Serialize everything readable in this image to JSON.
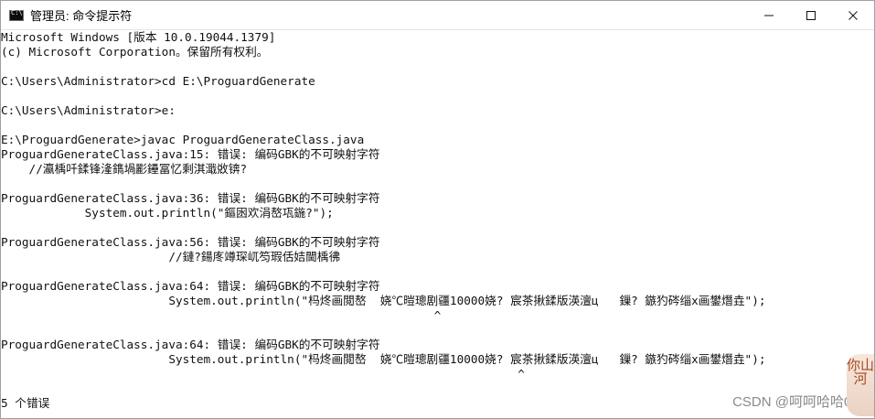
{
  "window": {
    "title": "管理员: 命令提示符",
    "icon": "command-prompt-icon",
    "controls": [
      "minimize-icon",
      "maximize-icon",
      "close-icon"
    ]
  },
  "terminal": {
    "lines": [
      "Microsoft Windows [版本 10.0.19044.1379]",
      "(c) Microsoft Corporation。保留所有权利。",
      "",
      "C:\\Users\\Administrator>cd E:\\ProguardGenerate",
      "",
      "C:\\Users\\Administrator>e:",
      "",
      "E:\\ProguardGenerate>javac ProguardGenerateClass.java",
      "ProguardGenerateClass.java:15: 错误: 编码GBK的不可映射字符",
      "    //瀛楀吀鍒锋湰鐫堝彲鑸冨忆剩淇濈敚锛?",
      "",
      "ProguardGenerateClass.java:36: 错误: 编码GBK的不可映射字符",
      "            System.out.println(\"鏂囦欢涓嶅瓨鍦?\");",
      "",
      "ProguardGenerateClass.java:56: 错误: 编码GBK的不可映射字符",
      "                        //鏈?鍚庝竴琛屼笉瑕佸姞閫楀彿",
      "",
      "ProguardGenerateClass.java:64: 错误: 编码GBK的不可映射字符",
      "                        System.out.println(\"杩炵画閲嶅  娆℃暟璁剧疆10000娆? 宸茶揪鍒版渶澶ц   鏁? 鏃犳硶缁х画鐢熸垚\");",
      "                                                              ^",
      "",
      "ProguardGenerateClass.java:64: 错误: 编码GBK的不可映射字符",
      "                        System.out.println(\"杩炵画閲嶅  娆℃暟璁剧疆10000娆? 宸茶揪鍒版渶澶ц   鏁? 鏃犳硶缁х画鐢熸垚\");",
      "                                                                          ^",
      "",
      "5 个错误"
    ]
  },
  "watermark": {
    "text": "CSDN @呵呵哈哈007",
    "sticker_text": "你山河"
  }
}
